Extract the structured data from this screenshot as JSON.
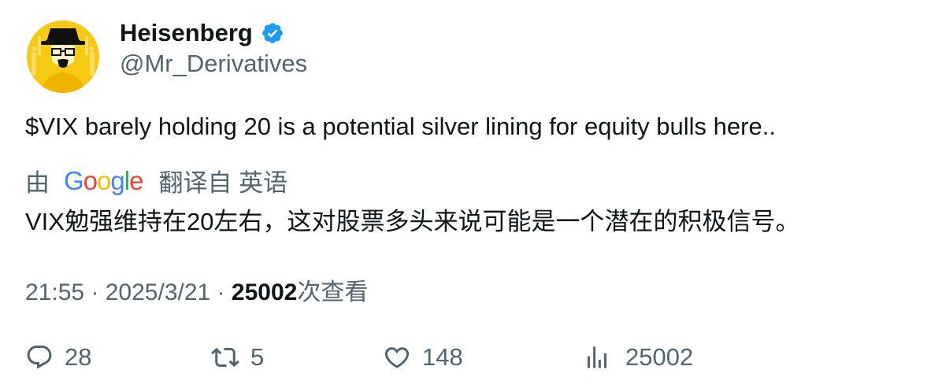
{
  "author": {
    "display_name": "Heisenberg",
    "handle": "@Mr_Derivatives",
    "verified": true,
    "avatar_icon": "heisenberg-avatar"
  },
  "tweet": {
    "text": "$VIX barely holding 20 is a potential silver lining for equity bulls here..",
    "translation": {
      "by_label": "由",
      "provider_letters": [
        "G",
        "o",
        "o",
        "g",
        "l",
        "e"
      ],
      "provider_colors": [
        "#4285F4",
        "#EA4335",
        "#FBBC05",
        "#4285F4",
        "#34A853",
        "#EA4335"
      ],
      "action_label": "翻译自 英语",
      "text": "VIX勉强维持在20左右，这对股票多头来说可能是一个潜在的积极信号。"
    },
    "meta": {
      "time": "21:55",
      "separator": " · ",
      "date": "2025/3/21",
      "views_count": "25002",
      "views_label": "次查看"
    }
  },
  "actions": {
    "reply_count": "28",
    "retweet_count": "5",
    "like_count": "148",
    "views_count": "25002"
  },
  "colors": {
    "text_primary": "#0f1419",
    "text_secondary": "#536471",
    "verified_blue": "#1d9bf0",
    "avatar_bg": "#f6c915"
  }
}
